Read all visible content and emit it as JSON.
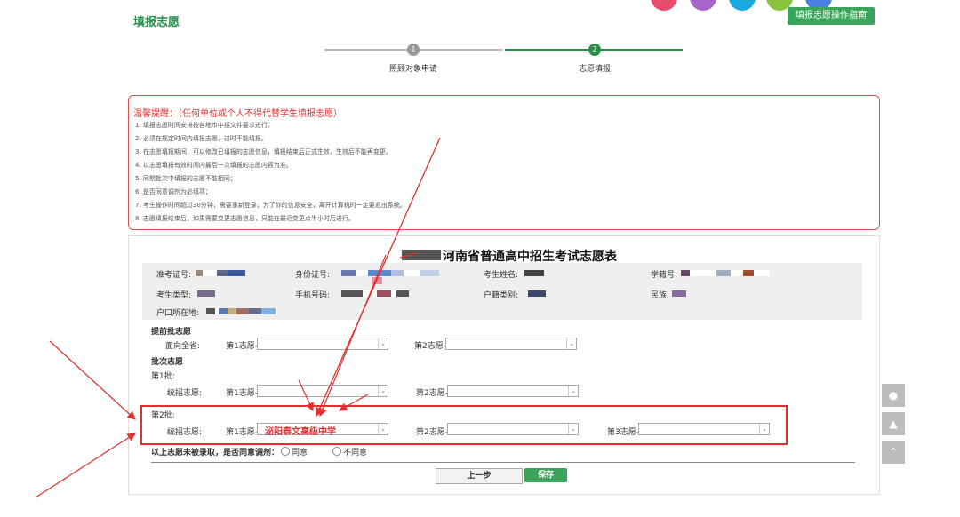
{
  "header": {
    "title": "填报志愿",
    "guide_button": "填报志愿操作指南",
    "circle_colors": [
      "#e84c6a",
      "#a665c8",
      "#19a8e0",
      "#8ac43f",
      "#4a7fe0"
    ]
  },
  "steps": [
    {
      "number": "1",
      "label": "照顾对象申请"
    },
    {
      "number": "2",
      "label": "志愿填报"
    }
  ],
  "notice": {
    "title": "温馨提醒：（任何单位或个人不得代替学生填报志愿）",
    "items": [
      "1. 填报志愿时间安排按各地市中招文件要求进行。",
      "2. 必须在规定时间内填报志愿，过时不能填报。",
      "3. 在志愿填报期间，可以修改已填报的志愿信息，填报结束后正式生效，生效后不能再变更。",
      "4. 以志愿填报有效时间内最后一次填报的志愿内容为准。",
      "5. 同期批次中填报的志愿不能相同；",
      "6. 是否同意调剂为必填项；",
      "7. 考生操作时间超过30分钟，需要重新登录，为了你的信息安全，离开计算机时一定要退出系统。",
      "8. 志愿填报结束后，如果需要变更志愿信息，只能在最近变更点半小时后进行。"
    ]
  },
  "form": {
    "title": "河南省普通高中招生考试志愿表",
    "fields": {
      "exam_no": "准考证号:",
      "id_no": "身份证号:",
      "name": "考生姓名:",
      "school_status": "学籍号:",
      "type": "考生类型:",
      "phone": "手机号码:",
      "hukou_type": "户籍类别:",
      "ethnic": "民族:",
      "hukou_place": "户口所在地:"
    },
    "early_batch": {
      "heading": "提前批志愿",
      "row_label": "面向全省:",
      "choice1": "第1志愿-",
      "choice2": "第2志愿-"
    },
    "batch_heading": "批次志愿",
    "batch1": {
      "heading": "第1批:",
      "row_label": "统招志愿:",
      "choice1": "第1志愿-",
      "choice2": "第2志愿-"
    },
    "batch2": {
      "heading": "第2批:",
      "row_label": "统招志愿:",
      "choice1": "第1志愿-",
      "choice1_value": "泌阳泰文高级中学",
      "choice2": "第2志愿-",
      "choice3": "第3志愿-"
    },
    "adjust": {
      "question": "以上志愿未被录取，是否同意调剂：",
      "agree": "同意",
      "disagree": "不同意"
    },
    "buttons": {
      "prev": "上一步",
      "save": "保存"
    }
  },
  "colors": {
    "brand_green": "#3aa55a",
    "alert_red": "#e03030"
  }
}
